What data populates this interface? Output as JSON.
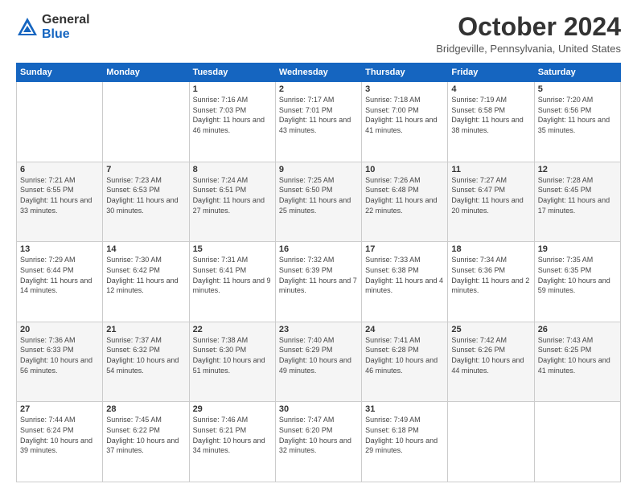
{
  "header": {
    "logo_general": "General",
    "logo_blue": "Blue",
    "title": "October 2024",
    "location": "Bridgeville, Pennsylvania, United States"
  },
  "days_of_week": [
    "Sunday",
    "Monday",
    "Tuesday",
    "Wednesday",
    "Thursday",
    "Friday",
    "Saturday"
  ],
  "weeks": [
    [
      {
        "num": "",
        "info": ""
      },
      {
        "num": "",
        "info": ""
      },
      {
        "num": "1",
        "info": "Sunrise: 7:16 AM\nSunset: 7:03 PM\nDaylight: 11 hours and 46 minutes."
      },
      {
        "num": "2",
        "info": "Sunrise: 7:17 AM\nSunset: 7:01 PM\nDaylight: 11 hours and 43 minutes."
      },
      {
        "num": "3",
        "info": "Sunrise: 7:18 AM\nSunset: 7:00 PM\nDaylight: 11 hours and 41 minutes."
      },
      {
        "num": "4",
        "info": "Sunrise: 7:19 AM\nSunset: 6:58 PM\nDaylight: 11 hours and 38 minutes."
      },
      {
        "num": "5",
        "info": "Sunrise: 7:20 AM\nSunset: 6:56 PM\nDaylight: 11 hours and 35 minutes."
      }
    ],
    [
      {
        "num": "6",
        "info": "Sunrise: 7:21 AM\nSunset: 6:55 PM\nDaylight: 11 hours and 33 minutes."
      },
      {
        "num": "7",
        "info": "Sunrise: 7:23 AM\nSunset: 6:53 PM\nDaylight: 11 hours and 30 minutes."
      },
      {
        "num": "8",
        "info": "Sunrise: 7:24 AM\nSunset: 6:51 PM\nDaylight: 11 hours and 27 minutes."
      },
      {
        "num": "9",
        "info": "Sunrise: 7:25 AM\nSunset: 6:50 PM\nDaylight: 11 hours and 25 minutes."
      },
      {
        "num": "10",
        "info": "Sunrise: 7:26 AM\nSunset: 6:48 PM\nDaylight: 11 hours and 22 minutes."
      },
      {
        "num": "11",
        "info": "Sunrise: 7:27 AM\nSunset: 6:47 PM\nDaylight: 11 hours and 20 minutes."
      },
      {
        "num": "12",
        "info": "Sunrise: 7:28 AM\nSunset: 6:45 PM\nDaylight: 11 hours and 17 minutes."
      }
    ],
    [
      {
        "num": "13",
        "info": "Sunrise: 7:29 AM\nSunset: 6:44 PM\nDaylight: 11 hours and 14 minutes."
      },
      {
        "num": "14",
        "info": "Sunrise: 7:30 AM\nSunset: 6:42 PM\nDaylight: 11 hours and 12 minutes."
      },
      {
        "num": "15",
        "info": "Sunrise: 7:31 AM\nSunset: 6:41 PM\nDaylight: 11 hours and 9 minutes."
      },
      {
        "num": "16",
        "info": "Sunrise: 7:32 AM\nSunset: 6:39 PM\nDaylight: 11 hours and 7 minutes."
      },
      {
        "num": "17",
        "info": "Sunrise: 7:33 AM\nSunset: 6:38 PM\nDaylight: 11 hours and 4 minutes."
      },
      {
        "num": "18",
        "info": "Sunrise: 7:34 AM\nSunset: 6:36 PM\nDaylight: 11 hours and 2 minutes."
      },
      {
        "num": "19",
        "info": "Sunrise: 7:35 AM\nSunset: 6:35 PM\nDaylight: 10 hours and 59 minutes."
      }
    ],
    [
      {
        "num": "20",
        "info": "Sunrise: 7:36 AM\nSunset: 6:33 PM\nDaylight: 10 hours and 56 minutes."
      },
      {
        "num": "21",
        "info": "Sunrise: 7:37 AM\nSunset: 6:32 PM\nDaylight: 10 hours and 54 minutes."
      },
      {
        "num": "22",
        "info": "Sunrise: 7:38 AM\nSunset: 6:30 PM\nDaylight: 10 hours and 51 minutes."
      },
      {
        "num": "23",
        "info": "Sunrise: 7:40 AM\nSunset: 6:29 PM\nDaylight: 10 hours and 49 minutes."
      },
      {
        "num": "24",
        "info": "Sunrise: 7:41 AM\nSunset: 6:28 PM\nDaylight: 10 hours and 46 minutes."
      },
      {
        "num": "25",
        "info": "Sunrise: 7:42 AM\nSunset: 6:26 PM\nDaylight: 10 hours and 44 minutes."
      },
      {
        "num": "26",
        "info": "Sunrise: 7:43 AM\nSunset: 6:25 PM\nDaylight: 10 hours and 41 minutes."
      }
    ],
    [
      {
        "num": "27",
        "info": "Sunrise: 7:44 AM\nSunset: 6:24 PM\nDaylight: 10 hours and 39 minutes."
      },
      {
        "num": "28",
        "info": "Sunrise: 7:45 AM\nSunset: 6:22 PM\nDaylight: 10 hours and 37 minutes."
      },
      {
        "num": "29",
        "info": "Sunrise: 7:46 AM\nSunset: 6:21 PM\nDaylight: 10 hours and 34 minutes."
      },
      {
        "num": "30",
        "info": "Sunrise: 7:47 AM\nSunset: 6:20 PM\nDaylight: 10 hours and 32 minutes."
      },
      {
        "num": "31",
        "info": "Sunrise: 7:49 AM\nSunset: 6:18 PM\nDaylight: 10 hours and 29 minutes."
      },
      {
        "num": "",
        "info": ""
      },
      {
        "num": "",
        "info": ""
      }
    ]
  ]
}
